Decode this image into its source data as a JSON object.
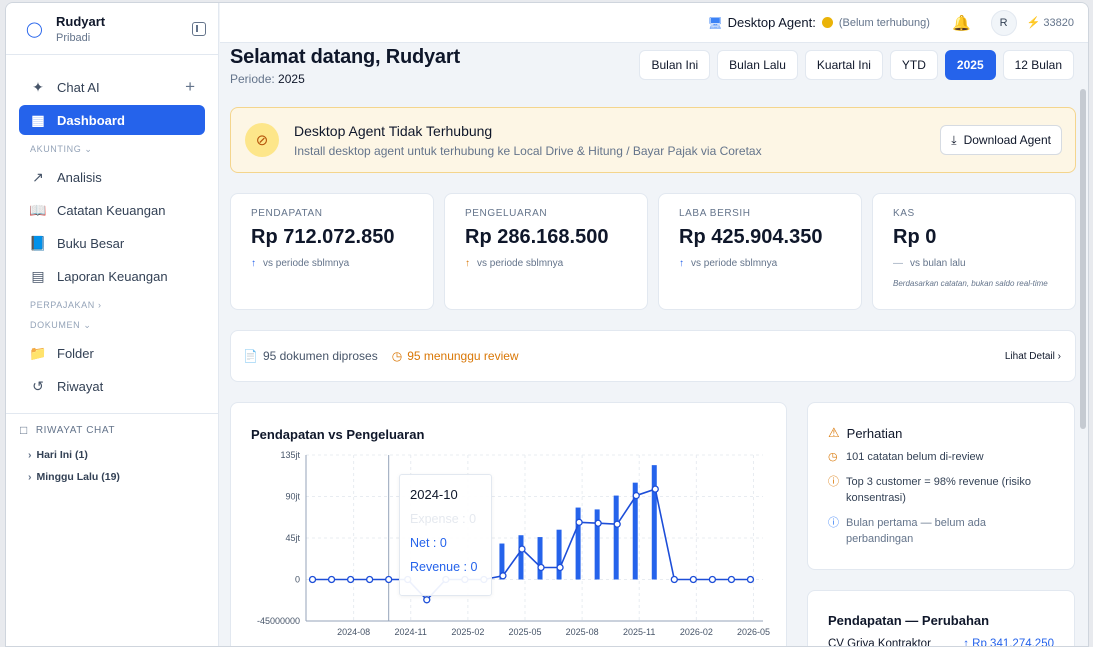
{
  "user": {
    "name": "Rudyart",
    "subtitle": "Pribadi"
  },
  "sidebar": {
    "items": [
      {
        "label": "Chat AI",
        "icon": "sparkle-icon"
      },
      {
        "label": "Dashboard",
        "icon": "grid-icon"
      },
      {
        "label": "Analisis",
        "icon": "trend-icon"
      },
      {
        "label": "Catatan Keuangan",
        "icon": "book-icon"
      },
      {
        "label": "Buku Besar",
        "icon": "book-open-icon"
      },
      {
        "label": "Laporan Keuangan",
        "icon": "bar-chart-icon"
      },
      {
        "label": "Folder",
        "icon": "folder-icon"
      },
      {
        "label": "Riwayat",
        "icon": "history-icon"
      }
    ],
    "sections": {
      "akunting": "AKUNTING",
      "perpajakan": "PERPAJAKAN",
      "dokumen": "DOKUMEN"
    },
    "chat_history": {
      "title": "RIWAYAT CHAT",
      "groups": [
        "Hari Ini (1)",
        "Minggu Lalu (19)"
      ]
    }
  },
  "topbar": {
    "agent_label": "Desktop Agent:",
    "agent_status": "(Belum terhubung)",
    "avatar": "R",
    "credits": "33820"
  },
  "header": {
    "greeting": "Selamat datang, Rudyart",
    "period_label": "Periode:",
    "period_value": "2025",
    "periods": [
      "Bulan Ini",
      "Bulan Lalu",
      "Kuartal Ini",
      "YTD",
      "2025",
      "12 Bulan"
    ],
    "active_period": "2025"
  },
  "banner": {
    "title": "Desktop Agent Tidak Terhubung",
    "subtitle": "Install desktop agent untuk terhubung ke Local Drive & Hitung / Bayar Pajak via Coretax",
    "button": "Download Agent"
  },
  "stats": [
    {
      "label": "PENDAPATAN",
      "value": "Rp 712.072.850",
      "change": "vs periode sblmnya",
      "arrow": "↑",
      "arrow_color": "#2563eb"
    },
    {
      "label": "PENGELUARAN",
      "value": "Rp 286.168.500",
      "change": "vs periode sblmnya",
      "arrow": "↑",
      "arrow_color": "#d97706"
    },
    {
      "label": "LABA BERSIH",
      "value": "Rp 425.904.350",
      "change": "vs periode sblmnya",
      "arrow": "↑",
      "arrow_color": "#2563eb"
    },
    {
      "label": "KAS",
      "value": "Rp 0",
      "change": "vs bulan lalu",
      "arrow": "—",
      "arrow_color": "#94a3b8",
      "note": "Berdasarkan catatan, bukan saldo real-time"
    }
  ],
  "docs": {
    "processed": "95 dokumen diproses",
    "pending": "95 menunggu review",
    "link": "Lihat Detail"
  },
  "chart_title": "Pendapatan vs Pengeluaran",
  "chart_data": {
    "type": "bar",
    "title": "Pendapatan vs Pengeluaran",
    "y_ticks": [
      "135jt",
      "90jt",
      "45jt",
      "0",
      "-45000000"
    ],
    "ylim": [
      -45000000,
      135000000
    ],
    "x_ticks": [
      "2024-08",
      "2024-11",
      "2025-02",
      "2025-05",
      "2025-08",
      "2025-11",
      "2026-02",
      "2026-05"
    ],
    "categories": [
      "2024-06",
      "2024-07",
      "2024-08",
      "2024-09",
      "2024-10",
      "2024-11",
      "2024-12",
      "2025-01",
      "2025-02",
      "2025-03",
      "2025-04",
      "2025-05",
      "2025-06",
      "2025-07",
      "2025-08",
      "2025-09",
      "2025-10",
      "2025-11",
      "2025-12",
      "2026-01",
      "2026-02",
      "2026-03",
      "2026-04",
      "2026-05"
    ],
    "series": [
      {
        "name": "Revenue",
        "type": "bar",
        "values": [
          0,
          0,
          0,
          0,
          0,
          0,
          0,
          0,
          0,
          0,
          39000000,
          48000000,
          46000000,
          54000000,
          78000000,
          76000000,
          91000000,
          105000000,
          124000000,
          0,
          0,
          0,
          0,
          0
        ]
      },
      {
        "name": "Net",
        "type": "line",
        "values": [
          0,
          0,
          0,
          0,
          0,
          0,
          -22000000,
          0,
          0,
          0,
          4000000,
          33000000,
          13000000,
          13000000,
          62000000,
          61000000,
          60000000,
          91000000,
          98000000,
          0,
          0,
          0,
          0,
          0
        ]
      }
    ],
    "grid": true,
    "tooltip": {
      "title": "2024-10",
      "rows": [
        {
          "label": "Expense : 0",
          "color": "#e5e9ef"
        },
        {
          "label": "Net : 0",
          "color": "#2563eb"
        },
        {
          "label": "Revenue : 0",
          "color": "#2563eb"
        }
      ]
    }
  },
  "attention": {
    "title": "Perhatian",
    "items": [
      {
        "text": "101 catatan belum di-review",
        "icon": "clock-icon",
        "color": "#d97706"
      },
      {
        "text": "Top 3 customer = 98% revenue (risiko konsentrasi)",
        "icon": "alert-icon",
        "color": "#d97706"
      },
      {
        "text": "Bulan pertama — belum ada perbandingan",
        "icon": "info-icon",
        "color": "#3b82f6"
      }
    ]
  },
  "revenue_change": {
    "title": "Pendapatan — Perubahan",
    "rows": [
      {
        "name": "CV Griya Kontraktor",
        "value": "↑ Rp 341.274.250"
      }
    ]
  },
  "colors": {
    "accent": "#2563eb",
    "warning": "#d97706"
  }
}
